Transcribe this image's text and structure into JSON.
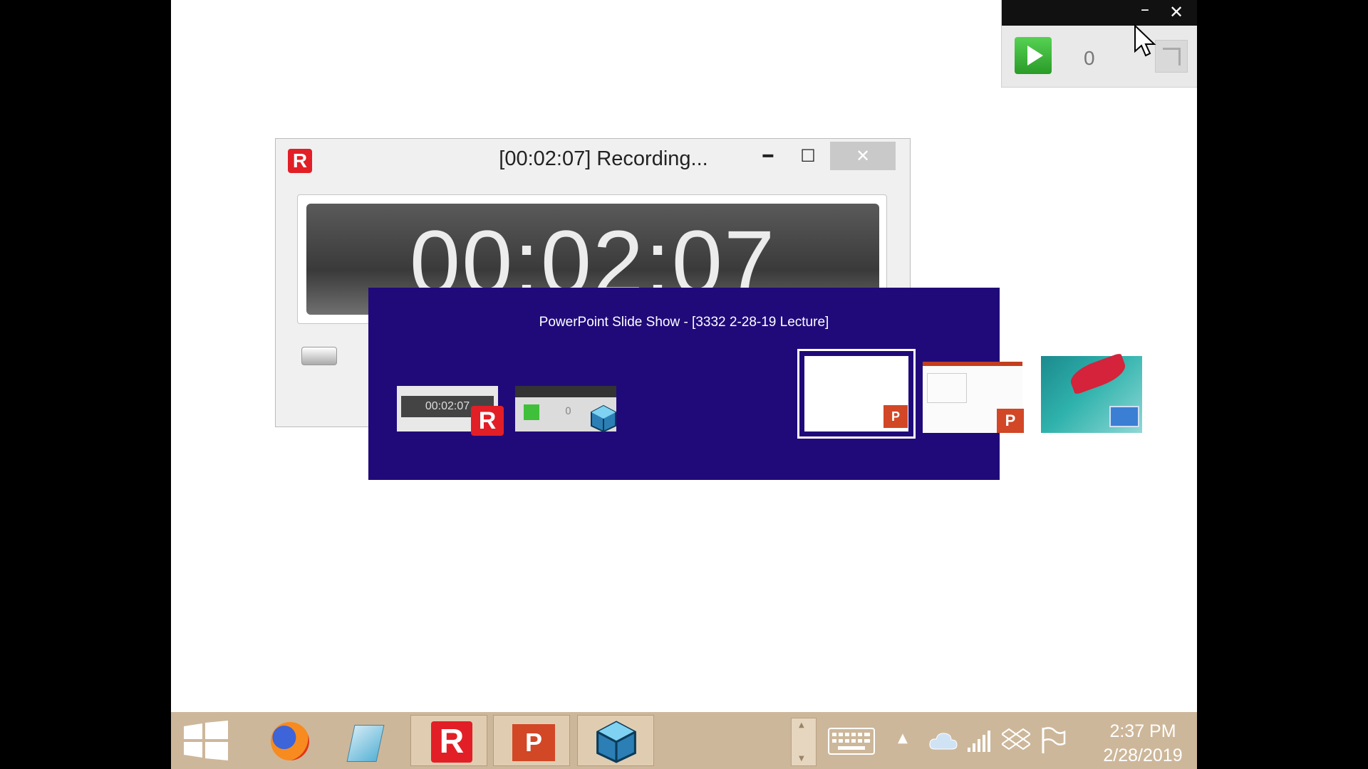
{
  "mini_toolbar": {
    "minimize_icon": "minimize-icon",
    "close_icon": "close-icon",
    "play_icon": "play-icon",
    "counter": "0",
    "expand_icon": "expand-icon"
  },
  "recorder": {
    "logo": "R",
    "title": "[00:02:07] Recording...",
    "elapsed": "00:02:07"
  },
  "switcher": {
    "title": "PowerPoint Slide Show - [3332 2-28-19 Lecture]",
    "thumb1_time": "00:02:07",
    "thumb2_count": "0",
    "r_badge": "R",
    "p_badge": "P"
  },
  "taskbar": {
    "recorder_label": "R",
    "powerpoint_label": "P",
    "time": "2:37 PM",
    "date": "2/28/2019"
  },
  "colors": {
    "switcher_bg": "#200a7a",
    "taskbar_bg": "#cdb79a",
    "accent_red": "#e21f26",
    "play_green": "#3fbf3a"
  }
}
